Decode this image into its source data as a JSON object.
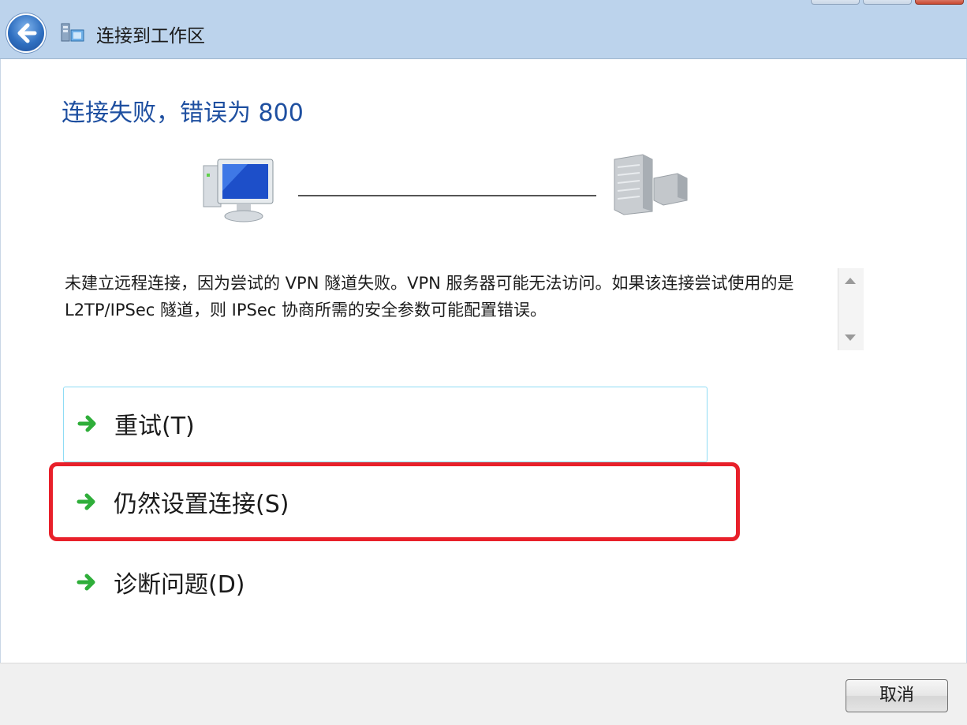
{
  "window": {
    "title": "连接到工作区"
  },
  "main": {
    "heading": "连接失败，错误为 800",
    "description": "未建立远程连接，因为尝试的 VPN 隧道失败。VPN 服务器可能无法访问。如果该连接尝试使用的是 L2TP/IPSec 隧道，则 IPSec 协商所需的安全参数可能配置错误。",
    "commands": [
      {
        "label": "重试(T)",
        "icon": "green-arrow-icon"
      },
      {
        "label": "仍然设置连接(S)",
        "icon": "green-arrow-icon"
      },
      {
        "label": "诊断问题(D)",
        "icon": "green-arrow-icon"
      }
    ]
  },
  "footer": {
    "cancel_label": "取消"
  },
  "colors": {
    "heading": "#1e4fa0",
    "highlight": "#e8202a",
    "titlebar": "#bcd3ec"
  }
}
